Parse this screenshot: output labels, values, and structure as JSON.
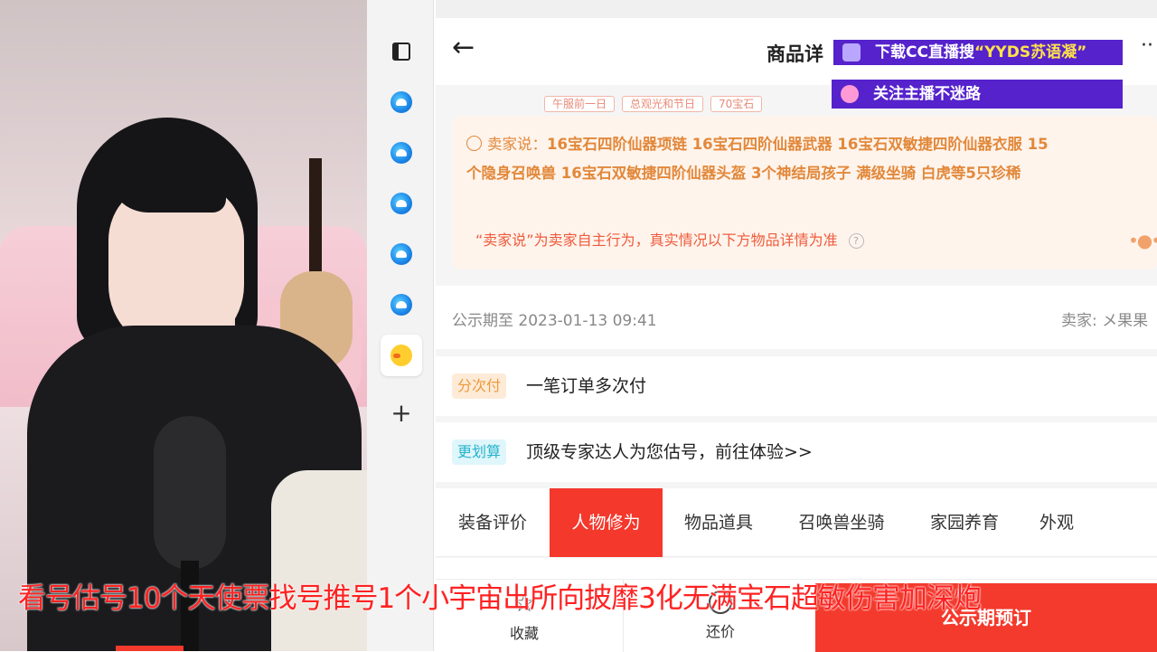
{
  "header": {
    "back_glyph": "←",
    "title": "商品详",
    "more_glyph": "··"
  },
  "tags": [
    "午服前一日",
    "总观光和节日",
    "70宝石"
  ],
  "seller_says": {
    "label": "卖家说：",
    "line1": "16宝石四阶仙器项链 16宝石四阶仙器武器 16宝石双敏捷四阶仙器衣服 15",
    "line2": "个隐身召唤兽 16宝石双敏捷四阶仙器头盔 3个神结局孩子 满级坐骑 白虎等5只珍稀",
    "disclaimer": "“卖家说”为卖家自主行为，真实情况以下方物品详情为准",
    "help_glyph": "?",
    "dots_glyph": "•●•"
  },
  "info": {
    "public_period": "公示期至 2023-01-13 09:41",
    "seller": "卖家: メ果果"
  },
  "features": [
    {
      "badge": "分次付",
      "text": "一笔订单多次付"
    },
    {
      "badge": "更划算",
      "text": "顶级专家达人为您估号，前往体验>>"
    }
  ],
  "tabs": [
    "装备评价",
    "人物修为",
    "物品道具",
    "召唤兽坐骑",
    "家园养育",
    "外观"
  ],
  "active_tab": "人物修为",
  "actionbar": {
    "favorite_label": "收藏",
    "bargain_label": "还价",
    "order_label": "公示期预订"
  },
  "overlays": {
    "download_prefix": "下载CC直播搜",
    "download_highlight": "“YYDS苏语凝",
    "download_suffix": "”",
    "follow": "关注主播不迷路"
  },
  "marquee": "看号估号10个天使票找号推号1个小宇宙出所向披靡3化无满宝石超敏伤害加深炮",
  "colors": {
    "accent_red": "#f33a2c",
    "seller_orange": "#e2883a",
    "overlay_purple": "#5522cc"
  }
}
